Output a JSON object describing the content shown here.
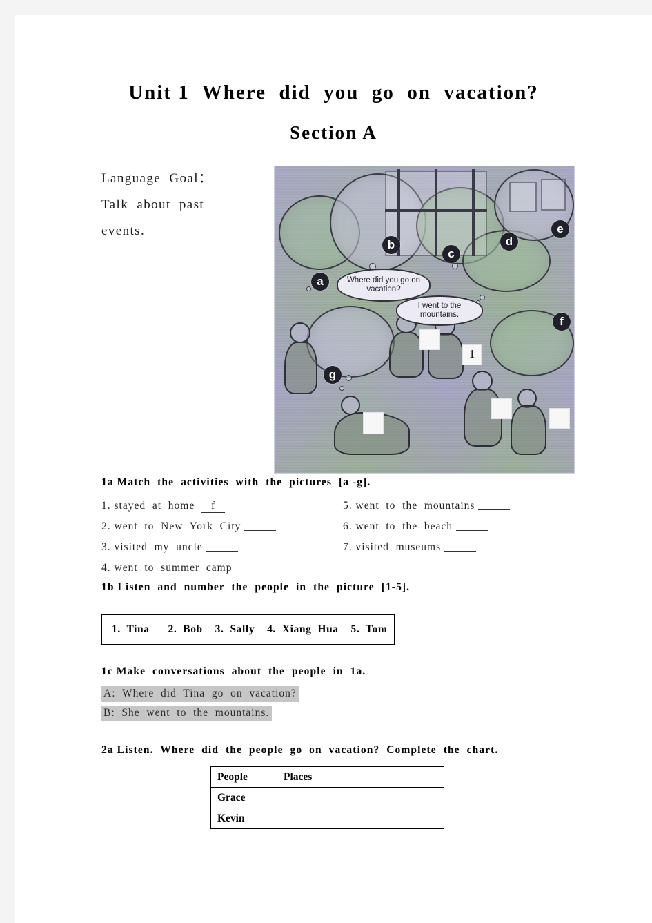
{
  "page": {
    "title_line1": "Unit 1  Where  did  you  go  on  vacation?",
    "title_line2": "Section  A"
  },
  "language_goal": {
    "label": "Language  Goal：",
    "line1": "Talk  about  past",
    "line2": "events."
  },
  "illustration": {
    "alt_name": "vacation-scene-illustration",
    "markers": [
      "a",
      "b",
      "c",
      "d",
      "e",
      "f",
      "g"
    ],
    "speech_bubble_question": "Where did you go\non vacation?",
    "speech_bubble_answer": "I went to the\nmountains.",
    "number_labels": [
      "1"
    ],
    "empty_number_boxes": 5,
    "bg_color": "#a9a7c6",
    "accent_color": "#20202a"
  },
  "ex_1a": {
    "heading": "1a Match  the  activities  with  the  pictures  [a -g].",
    "items_left": [
      {
        "num": "1.",
        "text": "stayed  at  home",
        "answer": "f"
      },
      {
        "num": "2.",
        "text": "went  to  New  York  City",
        "answer": ""
      },
      {
        "num": "3.",
        "text": "visited  my  uncle",
        "answer": ""
      },
      {
        "num": "4.",
        "text": "went  to  summer  camp",
        "answer": ""
      }
    ],
    "items_right": [
      {
        "num": "5.",
        "text": "went  to  the  mountains",
        "answer": ""
      },
      {
        "num": "6.",
        "text": "went  to  the  beach",
        "answer": ""
      },
      {
        "num": "7.",
        "text": "visited  museums",
        "answer": ""
      }
    ]
  },
  "ex_1b": {
    "heading": "1b Listen  and  number  the  people  in  the  picture  [1-5].",
    "names": "1.  Tina      2.  Bob    3.  Sally    4.  Xiang  Hua    5.  Tom"
  },
  "ex_1c": {
    "heading": "1c Make  conversations  about  the  people  in  1a.",
    "line_a": "A:  Where  did  Tina  go  on  vacation?",
    "line_b": "B:  She  went  to  the  mountains.",
    "highlight_color": "#c6c6c6"
  },
  "ex_2a": {
    "heading": "2a Listen.  Where  did  the  people  go  on  vacation?  Complete  the  chart.",
    "table": {
      "headers": [
        "People",
        "Places"
      ],
      "rows": [
        {
          "people": "Grace",
          "places": ""
        },
        {
          "people": "Kevin",
          "places": ""
        }
      ]
    }
  }
}
